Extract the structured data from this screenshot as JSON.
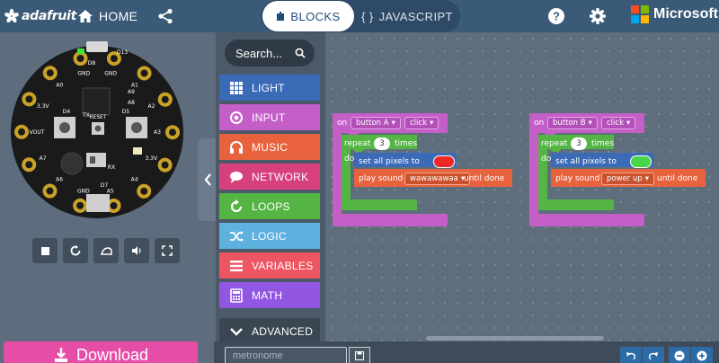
{
  "header": {
    "brand": "adafruit",
    "home_label": "HOME",
    "mode_blocks": "BLOCKS",
    "mode_javascript": "JAVASCRIPT",
    "account": "Microsoft"
  },
  "simulator": {
    "pad_labels": [
      "GND",
      "A1",
      "A2",
      "A3",
      "3.3V",
      "A4",
      "A5",
      "GND",
      "A6",
      "A7",
      "VOUT",
      "3.3V",
      "A0",
      "GND"
    ],
    "board_labels": [
      "D13",
      "D8",
      "A8",
      "A9",
      "D4",
      "RESET",
      "D5",
      "D7",
      "TX",
      "RX"
    ],
    "controls": [
      "stop-icon",
      "restart-icon",
      "slowmo-icon",
      "mute-icon",
      "fullscreen-icon"
    ]
  },
  "toolbox": {
    "search_placeholder": "Search...",
    "categories": [
      {
        "label": "LIGHT",
        "color": "#3b6ab7",
        "icon": "grid-icon"
      },
      {
        "label": "INPUT",
        "color": "#c45fc8",
        "icon": "target-icon"
      },
      {
        "label": "MUSIC",
        "color": "#e8623d",
        "icon": "headphones-icon"
      },
      {
        "label": "NETWORK",
        "color": "#d6407c",
        "icon": "chat-icon"
      },
      {
        "label": "LOOPS",
        "color": "#55b544",
        "icon": "refresh-icon"
      },
      {
        "label": "LOGIC",
        "color": "#5fb2df",
        "icon": "shuffle-icon"
      },
      {
        "label": "VARIABLES",
        "color": "#ec5561",
        "icon": "list-icon"
      },
      {
        "label": "MATH",
        "color": "#9157e3",
        "icon": "calculator-icon"
      },
      {
        "label": "ADVANCED",
        "color": "#3a4753",
        "icon": "chevron-down-icon"
      }
    ]
  },
  "workspace": {
    "scripts": [
      {
        "event_on": "on",
        "button": "button A",
        "action": "click",
        "repeat_label": "repeat",
        "repeat_count": "3",
        "times_label": "times",
        "do_label": "do",
        "set_pixels_label": "set all pixels to",
        "pixel_color": "#ee2727",
        "play_sound_label": "play sound",
        "sound": "wawawawaa",
        "until_done": "until done"
      },
      {
        "event_on": "on",
        "button": "button B",
        "action": "click",
        "repeat_label": "repeat",
        "repeat_count": "3",
        "times_label": "times",
        "do_label": "do",
        "set_pixels_label": "set all pixels to",
        "pixel_color": "#48d548",
        "play_sound_label": "play sound",
        "sound": "power up",
        "until_done": "until done"
      }
    ]
  },
  "bottom": {
    "download_label": "Download",
    "project_name_placeholder": "metronome"
  },
  "colors": {
    "header": "#3a5a78",
    "input_block": "#c45fc8",
    "loops_block": "#55b544",
    "light_block": "#3b6ab7",
    "music_block": "#e8623d",
    "download": "#e54da6"
  }
}
